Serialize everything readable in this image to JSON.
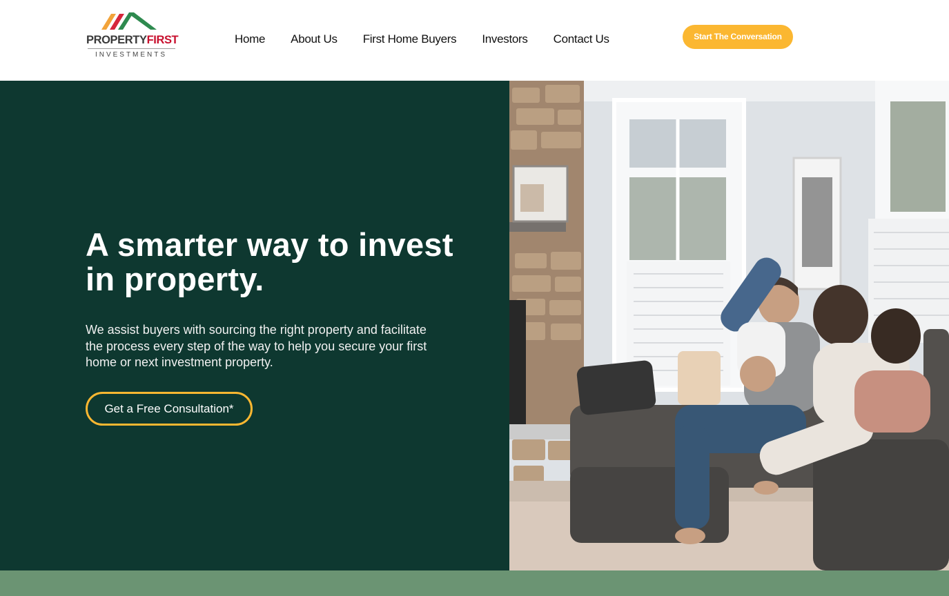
{
  "header": {
    "logo": {
      "brand_part1": "PROPERTY",
      "brand_part2": "FIRST",
      "tagline": "INVESTMENTS",
      "icon": "house-roof-stripes-icon",
      "colors": {
        "stripe1": "#f2a33a",
        "stripe2": "#d6263b",
        "roof": "#2e8a4f",
        "text_dark": "#3a3a3a",
        "text_red": "#c8102e"
      }
    },
    "nav": [
      "Home",
      "About Us",
      "First Home Buyers",
      "Investors",
      "Contact Us"
    ],
    "cta_label": "Start The Conversation"
  },
  "hero": {
    "title": "A smarter way to invest in property.",
    "description": "We assist buyers with sourcing the right property and facilitate the process every step of the way to help you secure your first home or next investment property.",
    "button_label": "Get a Free Consultation*",
    "photo": "family-playing-on-sofa-photo"
  },
  "colors": {
    "accent": "#fbb731",
    "hero_bg": "#0e3830",
    "band": "#6b9473",
    "white": "#ffffff"
  }
}
